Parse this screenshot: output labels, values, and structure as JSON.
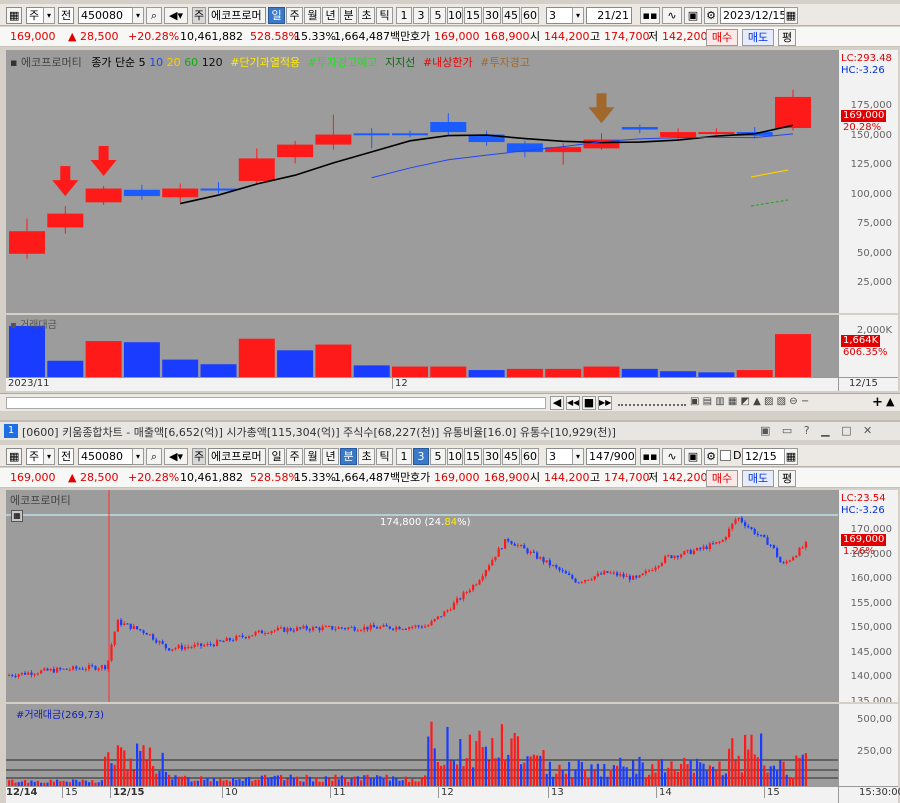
{
  "toolbar_top": {
    "market": "주",
    "market_all": "전",
    "code": "450080",
    "name": "에코프로머",
    "periods": [
      "일",
      "주",
      "월",
      "년",
      "분",
      "초",
      "틱"
    ],
    "selected_period": "일",
    "intervals": [
      "1",
      "3",
      "5",
      "10",
      "15",
      "30",
      "45",
      "60"
    ],
    "count": "3",
    "page": "21/21",
    "date": "2023/12/15"
  },
  "info_top": {
    "price": "169,000",
    "change": "▲  28,500",
    "rate": "+20.28%",
    "volume": "10,461,882",
    "vol_ratio": "528.58%",
    "turnover": "15.33%",
    "amount": "1,664,487백만",
    "quote_label": "호가",
    "ask": "169,000",
    "bid": "168,900",
    "open_label": "시",
    "open": "144,200",
    "high_label": "고",
    "high": "174,700",
    "low_label": "저",
    "low": "142,200",
    "buy": "매수",
    "sell": "매도",
    "eval": "평"
  },
  "chart_top": {
    "title": "에코프로머티",
    "legend": [
      "종가 단순 5",
      "10",
      "20",
      "60",
      "120",
      "#단기과열적용",
      "#투자경고예고",
      "지지선",
      "#내상한가",
      "#투자경고"
    ],
    "lc": "LC:293.48",
    "hc": "HC:-3.26",
    "price_tag": "169,000",
    "pct_tag": "20.28%",
    "ticks": [
      "175,000",
      "150,000",
      "125,000",
      "100,000",
      "75,000",
      "50,000",
      "25,000"
    ],
    "volume_title": "거래대금",
    "vol_tag": "1,664K",
    "vol_pct": "606.35%",
    "vol_tick": "2,000K",
    "x_labels": [
      "2023/11",
      "12"
    ],
    "x_right": "12/15"
  },
  "chart_data": [
    {
      "type": "candlestick",
      "series": [
        {
          "name": "daily",
          "values": [
            {
              "o": 44000,
              "c": 62000,
              "h": 72000,
              "l": 40000,
              "up": true
            },
            {
              "o": 65000,
              "c": 76000,
              "h": 82000,
              "l": 60000,
              "up": true
            },
            {
              "o": 85000,
              "c": 96000,
              "h": 98000,
              "l": 83000,
              "up": true
            },
            {
              "o": 95000,
              "c": 90000,
              "h": 99000,
              "l": 87000,
              "up": false
            },
            {
              "o": 89000,
              "c": 96000,
              "h": 100000,
              "l": 85000,
              "up": true
            },
            {
              "o": 96000,
              "c": 96000,
              "h": 101000,
              "l": 92000,
              "up": false
            },
            {
              "o": 102000,
              "c": 120000,
              "h": 128000,
              "l": 100000,
              "up": true
            },
            {
              "o": 121000,
              "c": 131000,
              "h": 134000,
              "l": 116000,
              "up": true
            },
            {
              "o": 131000,
              "c": 139000,
              "h": 155000,
              "l": 127000,
              "up": true
            },
            {
              "o": 140000,
              "c": 140000,
              "h": 144000,
              "l": 128000,
              "up": false
            },
            {
              "o": 140000,
              "c": 140000,
              "h": 142000,
              "l": 137000,
              "up": false
            },
            {
              "o": 149000,
              "c": 141000,
              "h": 156000,
              "l": 138000,
              "up": false
            },
            {
              "o": 139000,
              "c": 133000,
              "h": 142000,
              "l": 130000,
              "up": false
            },
            {
              "o": 132000,
              "c": 125000,
              "h": 134000,
              "l": 121000,
              "up": false
            },
            {
              "o": 125000,
              "c": 129000,
              "h": 132000,
              "l": 115000,
              "up": true
            },
            {
              "o": 128000,
              "c": 135000,
              "h": 140000,
              "l": 127000,
              "up": true
            },
            {
              "o": 145000,
              "c": 143000,
              "h": 147000,
              "l": 140000,
              "up": false
            },
            {
              "o": 137000,
              "c": 141000,
              "h": 144000,
              "l": 134000,
              "up": true
            },
            {
              "o": 141000,
              "c": 141000,
              "h": 144000,
              "l": 137000,
              "up": true
            },
            {
              "o": 141000,
              "c": 138000,
              "h": 145000,
              "l": 136000,
              "up": false
            },
            {
              "o": 144200,
              "c": 169000,
              "h": 174700,
              "l": 142200,
              "up": true
            }
          ]
        }
      ],
      "volume": [
        44,
        14,
        31,
        30,
        15,
        11,
        33,
        23,
        28,
        10,
        9,
        9,
        6,
        7,
        7,
        9,
        7,
        5,
        4,
        6,
        37
      ],
      "volume_up": [
        false,
        false,
        true,
        false,
        false,
        false,
        true,
        false,
        true,
        false,
        true,
        true,
        false,
        true,
        true,
        true,
        false,
        false,
        false,
        true,
        true
      ],
      "arrows": [
        1,
        2,
        15
      ],
      "ylim": [
        0,
        200000
      ]
    },
    {
      "type": "candlestick-minute",
      "start": 137500,
      "ylim": [
        131500,
        179000
      ]
    }
  ],
  "toolbar_mid": {
    "buttons": [
      "◀",
      "◀◀",
      "■",
      "▶▶"
    ],
    "zoom": [
      "−",
      "+",
      "▲"
    ]
  },
  "window2": {
    "num": "1",
    "title": "[0600] 키움종합차트 - 매출액[6,652(억)] 시가총액[115,304(억)] 주식수[68,227(천)] 유통비율[16.0] 유통수[10,929(천)]",
    "buttons": [
      "□",
      "▭",
      "?",
      "_",
      "□",
      "×"
    ]
  },
  "toolbar_bot": {
    "market": "주",
    "market_all": "전",
    "code": "450080",
    "name": "에코프로머",
    "periods": [
      "일",
      "주",
      "월",
      "년",
      "분",
      "초",
      "틱"
    ],
    "selected_period": "분",
    "intervals": [
      "1",
      "3",
      "5",
      "10",
      "15",
      "30",
      "45",
      "60"
    ],
    "selected_interval": "3",
    "count": "3",
    "page": "147/900",
    "date": "12/15",
    "d_label": "D"
  },
  "info_bot": {
    "price": "169,000",
    "change": "▲  28,500",
    "rate": "+20.28%",
    "volume": "10,461,882",
    "vol_ratio": "528.58%",
    "turnover": "15.33%",
    "amount": "1,664,487백만",
    "quote_label": "호가",
    "ask": "169,000",
    "bid": "168,900",
    "open_label": "시",
    "open": "144,200",
    "high_label": "고",
    "high": "174,700",
    "low_label": "저",
    "low": "142,200",
    "buy": "매수",
    "sell": "매도",
    "eval": "평"
  },
  "chart_bot": {
    "title": "에코프로머티",
    "lc": "LC:23.54",
    "hc": "HC:-3.26",
    "price_tag": "169,000",
    "pct_tag": "1.26%",
    "high_label": "174,800 (24.",
    "high_label_pct": "84",
    "high_label_end": "%)",
    "ticks": [
      "170,000",
      "165,000",
      "160,000",
      "155,000",
      "150,000",
      "145,000",
      "140,000",
      "135,000"
    ],
    "volume_title": "#거래대금(269,73)",
    "vol_ticks": [
      "500,00",
      "250,00"
    ],
    "x_labels": [
      "12/14",
      "15",
      "12/15",
      "10",
      "11",
      "12",
      "13",
      "14",
      "15"
    ],
    "x_time": "15:30:00"
  }
}
